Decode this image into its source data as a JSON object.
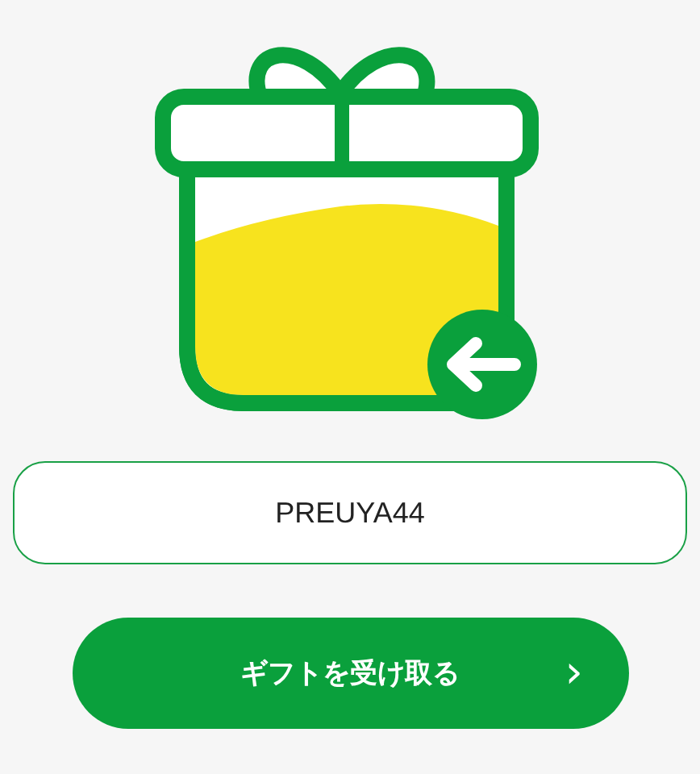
{
  "code_field": {
    "value": "PREUYA44"
  },
  "receive_button": {
    "label": "ギフトを受け取る",
    "chevron": "›"
  }
}
